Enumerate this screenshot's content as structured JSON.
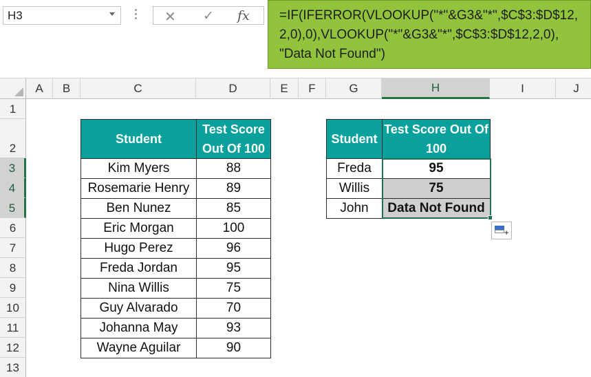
{
  "name_box": "H3",
  "formula_bar": {
    "cancel_icon": "x-icon",
    "enter_icon": "check-icon",
    "function_icon": "fx-icon",
    "function_label": "fx",
    "formula": "=IF(IFERROR(VLOOKUP(\"*\"&G3&\"*\",$C$3:$D$12,\n2,0),0),VLOOKUP(\"*\"&G3&\"*\",$C$3:$D$12,2,0),\n\"Data Not Found\")"
  },
  "columns": [
    "A",
    "B",
    "C",
    "D",
    "E",
    "F",
    "G",
    "H",
    "I",
    "J"
  ],
  "rows": [
    "1",
    "2",
    "3",
    "4",
    "5",
    "6",
    "7",
    "8",
    "9",
    "10",
    "11",
    "12",
    "13"
  ],
  "selected_column": "H",
  "selected_rows": [
    "3",
    "4",
    "5"
  ],
  "colors": {
    "header_fill": "#0aa19c",
    "formula_bar_highlight": "#92c33c",
    "selection_border": "#1f6f5a"
  },
  "table1": {
    "headers": [
      "Student",
      "Test Score Out Of 100"
    ],
    "rows": [
      [
        "Kim Myers",
        "88"
      ],
      [
        "Rosemarie Henry",
        "89"
      ],
      [
        "Ben Nunez",
        "85"
      ],
      [
        "Eric Morgan",
        "100"
      ],
      [
        "Hugo Perez",
        "96"
      ],
      [
        "Freda Jordan",
        "95"
      ],
      [
        "Nina Willis",
        "75"
      ],
      [
        "Guy Alvarado",
        "70"
      ],
      [
        "Johanna May",
        "93"
      ],
      [
        "Wayne Aguilar",
        "90"
      ]
    ]
  },
  "table2": {
    "headers": [
      "Student",
      "Test Score Out Of 100"
    ],
    "rows": [
      [
        "Freda",
        "95"
      ],
      [
        "Willis",
        "75"
      ],
      [
        "John",
        "Data Not Found"
      ]
    ]
  },
  "quick_analysis_icon": "quick-analysis-icon"
}
